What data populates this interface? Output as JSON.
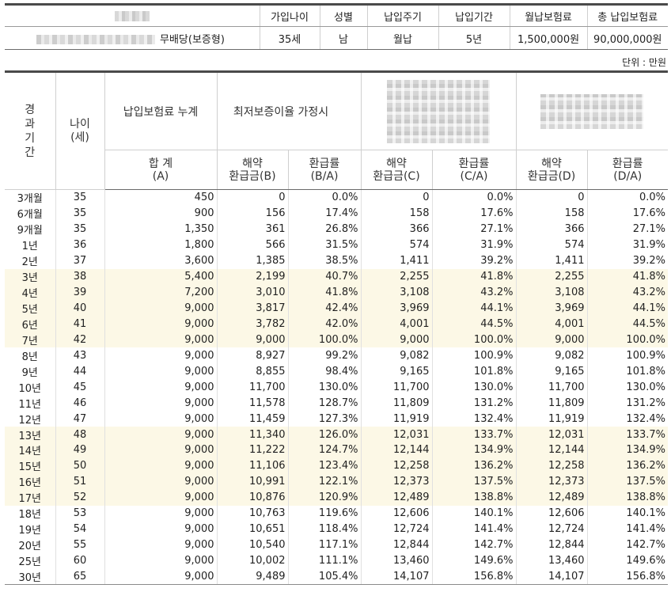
{
  "summary": {
    "headers": [
      "가입나이",
      "성별",
      "납입주기",
      "납입기간",
      "월납보험료",
      "총 납입보험료"
    ],
    "product_suffix": "무배당(보증형)",
    "values": [
      "35세",
      "남",
      "월납",
      "5년",
      "1,500,000원",
      "90,000,000원"
    ]
  },
  "unit_label": "단위 : 만원",
  "main_headers": {
    "elapsed": "경과기간",
    "age": "나이\n(세)",
    "cum_premium": "납입보험료 누계",
    "min_guarantee": "최저보증이율 가정시",
    "total": "합 계\n(A)",
    "surr_b": "해약\n환급금(B)",
    "rate_ba": "환급률\n(B/A)",
    "surr_c": "해약\n환급금(C)",
    "rate_ca": "환급률\n(C/A)",
    "surr_d": "해약\n환급금(D)",
    "rate_da": "환급률\n(D/A)"
  },
  "rows": [
    [
      "3개월",
      "35",
      "450",
      "0",
      "0.0%",
      "0",
      "0.0%",
      "0",
      "0.0%"
    ],
    [
      "6개월",
      "35",
      "900",
      "156",
      "17.4%",
      "158",
      "17.6%",
      "158",
      "17.6%"
    ],
    [
      "9개월",
      "35",
      "1,350",
      "361",
      "26.8%",
      "366",
      "27.1%",
      "366",
      "27.1%"
    ],
    [
      "1년",
      "36",
      "1,800",
      "566",
      "31.5%",
      "574",
      "31.9%",
      "574",
      "31.9%"
    ],
    [
      "2년",
      "37",
      "3,600",
      "1,385",
      "38.5%",
      "1,411",
      "39.2%",
      "1,411",
      "39.2%"
    ],
    [
      "3년",
      "38",
      "5,400",
      "2,199",
      "40.7%",
      "2,255",
      "41.8%",
      "2,255",
      "41.8%"
    ],
    [
      "4년",
      "39",
      "7,200",
      "3,010",
      "41.8%",
      "3,108",
      "43.2%",
      "3,108",
      "43.2%"
    ],
    [
      "5년",
      "40",
      "9,000",
      "3,817",
      "42.4%",
      "3,969",
      "44.1%",
      "3,969",
      "44.1%"
    ],
    [
      "6년",
      "41",
      "9,000",
      "3,782",
      "42.0%",
      "4,001",
      "44.5%",
      "4,001",
      "44.5%"
    ],
    [
      "7년",
      "42",
      "9,000",
      "9,000",
      "100.0%",
      "9,000",
      "100.0%",
      "9,000",
      "100.0%"
    ],
    [
      "8년",
      "43",
      "9,000",
      "8,927",
      "99.2%",
      "9,082",
      "100.9%",
      "9,082",
      "100.9%"
    ],
    [
      "9년",
      "44",
      "9,000",
      "8,855",
      "98.4%",
      "9,165",
      "101.8%",
      "9,165",
      "101.8%"
    ],
    [
      "10년",
      "45",
      "9,000",
      "11,700",
      "130.0%",
      "11,700",
      "130.0%",
      "11,700",
      "130.0%"
    ],
    [
      "11년",
      "46",
      "9,000",
      "11,578",
      "128.7%",
      "11,809",
      "131.2%",
      "11,809",
      "131.2%"
    ],
    [
      "12년",
      "47",
      "9,000",
      "11,459",
      "127.3%",
      "11,919",
      "132.4%",
      "11,919",
      "132.4%"
    ],
    [
      "13년",
      "48",
      "9,000",
      "11,340",
      "126.0%",
      "12,031",
      "133.7%",
      "12,031",
      "133.7%"
    ],
    [
      "14년",
      "49",
      "9,000",
      "11,222",
      "124.7%",
      "12,144",
      "134.9%",
      "12,144",
      "134.9%"
    ],
    [
      "15년",
      "50",
      "9,000",
      "11,106",
      "123.4%",
      "12,258",
      "136.2%",
      "12,258",
      "136.2%"
    ],
    [
      "16년",
      "51",
      "9,000",
      "10,991",
      "122.1%",
      "12,373",
      "137.5%",
      "12,373",
      "137.5%"
    ],
    [
      "17년",
      "52",
      "9,000",
      "10,876",
      "120.9%",
      "12,489",
      "138.8%",
      "12,489",
      "138.8%"
    ],
    [
      "18년",
      "53",
      "9,000",
      "10,763",
      "119.6%",
      "12,606",
      "140.1%",
      "12,606",
      "140.1%"
    ],
    [
      "19년",
      "54",
      "9,000",
      "10,651",
      "118.4%",
      "12,724",
      "141.4%",
      "12,724",
      "141.4%"
    ],
    [
      "20년",
      "55",
      "9,000",
      "10,540",
      "117.1%",
      "12,844",
      "142.7%",
      "12,844",
      "142.7%"
    ],
    [
      "25년",
      "60",
      "9,000",
      "10,002",
      "111.1%",
      "13,460",
      "149.6%",
      "13,460",
      "149.6%"
    ],
    [
      "30년",
      "65",
      "9,000",
      "9,489",
      "105.4%",
      "14,107",
      "156.8%",
      "14,107",
      "156.8%"
    ]
  ],
  "highlight_rows": [
    5,
    6,
    7,
    8,
    9,
    15,
    16,
    17,
    18,
    19
  ],
  "colors": {
    "highlight_bg": "#fcf8e6",
    "rule_dark": "#4a4a4a"
  }
}
